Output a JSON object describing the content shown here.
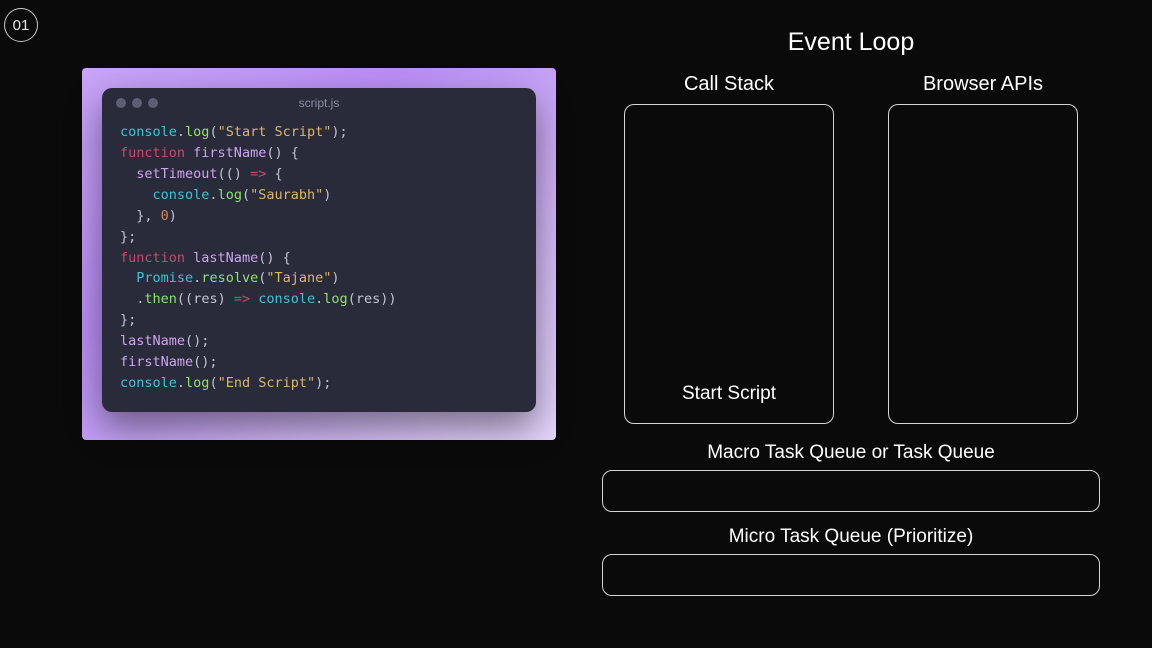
{
  "slide_number": "01",
  "editor": {
    "filename": "script.js",
    "code_tokens": [
      [
        [
          "tk-obj",
          "console"
        ],
        [
          "tk-punc",
          "."
        ],
        [
          "tk-method",
          "log"
        ],
        [
          "tk-punc",
          "("
        ],
        [
          "tk-str",
          "\"Start Script\""
        ],
        [
          "tk-punc",
          ");"
        ]
      ],
      [
        [
          "tk-kw",
          "function"
        ],
        [
          "",
          " "
        ],
        [
          "tk-fn",
          "firstName"
        ],
        [
          "tk-punc",
          "() {"
        ]
      ],
      [
        [
          "",
          "  "
        ],
        [
          "tk-fn",
          "setTimeout"
        ],
        [
          "tk-punc",
          "(() "
        ],
        [
          "tk-arrow",
          "=>"
        ],
        [
          "tk-punc",
          " {"
        ]
      ],
      [
        [
          "",
          "    "
        ],
        [
          "tk-obj",
          "console"
        ],
        [
          "tk-punc",
          "."
        ],
        [
          "tk-method",
          "log"
        ],
        [
          "tk-punc",
          "("
        ],
        [
          "tk-str",
          "\"Saurabh\""
        ],
        [
          "tk-punc",
          ")"
        ]
      ],
      [
        [
          "",
          "  "
        ],
        [
          "tk-punc",
          "}, "
        ],
        [
          "tk-num",
          "0"
        ],
        [
          "tk-punc",
          ")"
        ]
      ],
      [
        [
          "tk-punc",
          "};"
        ]
      ],
      [
        [
          "tk-kw",
          "function"
        ],
        [
          "",
          " "
        ],
        [
          "tk-fn",
          "lastName"
        ],
        [
          "tk-punc",
          "() {"
        ]
      ],
      [
        [
          "",
          "  "
        ],
        [
          "tk-obj",
          "Promise"
        ],
        [
          "tk-punc",
          "."
        ],
        [
          "tk-method",
          "resolve"
        ],
        [
          "tk-punc",
          "("
        ],
        [
          "tk-str",
          "\"Tajane\""
        ],
        [
          "tk-punc",
          ")"
        ]
      ],
      [
        [
          "",
          "  "
        ],
        [
          "tk-punc",
          "."
        ],
        [
          "tk-method",
          "then"
        ],
        [
          "tk-punc",
          "(("
        ],
        [
          "tk-param",
          "res"
        ],
        [
          "tk-punc",
          ") "
        ],
        [
          "tk-arrow",
          "=>"
        ],
        [
          "tk-punc",
          " "
        ],
        [
          "tk-obj",
          "console"
        ],
        [
          "tk-punc",
          "."
        ],
        [
          "tk-method",
          "log"
        ],
        [
          "tk-punc",
          "("
        ],
        [
          "tk-param",
          "res"
        ],
        [
          "tk-punc",
          "))"
        ]
      ],
      [
        [
          "tk-punc",
          "};"
        ]
      ],
      [
        [
          "tk-fn",
          "lastName"
        ],
        [
          "tk-punc",
          "();"
        ]
      ],
      [
        [
          "tk-fn",
          "firstName"
        ],
        [
          "tk-punc",
          "();"
        ]
      ],
      [
        [
          "tk-obj",
          "console"
        ],
        [
          "tk-punc",
          "."
        ],
        [
          "tk-method",
          "log"
        ],
        [
          "tk-punc",
          "("
        ],
        [
          "tk-str",
          "\"End Script\""
        ],
        [
          "tk-punc",
          ");"
        ]
      ]
    ]
  },
  "diagram": {
    "title": "Event Loop",
    "call_stack": {
      "label": "Call Stack",
      "items": [
        "Start Script"
      ]
    },
    "browser_apis": {
      "label": "Browser APIs",
      "items": []
    },
    "macro_queue": {
      "label": "Macro Task Queue or Task Queue",
      "items": []
    },
    "micro_queue": {
      "label": "Micro Task Queue (Prioritize)",
      "items": []
    }
  }
}
